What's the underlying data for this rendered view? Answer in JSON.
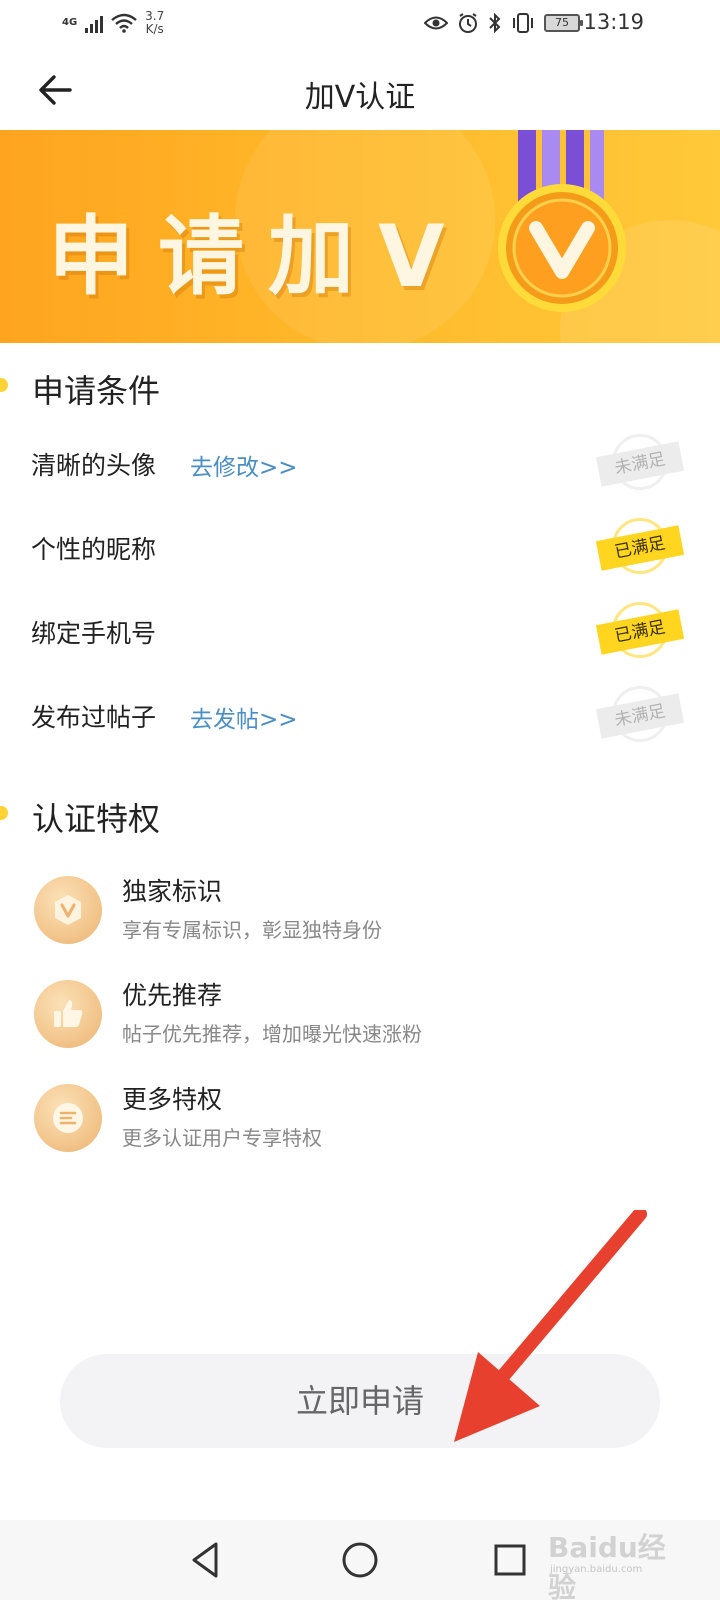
{
  "status_bar": {
    "network": "4G",
    "speed_value": "3.7",
    "speed_unit": "K/s",
    "battery": "75",
    "time": "13:19"
  },
  "header": {
    "title": "加V认证"
  },
  "banner": {
    "title": "申请加V"
  },
  "conditions": {
    "title": "申请条件",
    "items": [
      {
        "label": "清晰的头像",
        "link": "去修改>>",
        "status": "未满足"
      },
      {
        "label": "个性的昵称",
        "link": "",
        "status": "已满足"
      },
      {
        "label": "绑定手机号",
        "link": "",
        "status": "已满足"
      },
      {
        "label": "发布过帖子",
        "link": "去发帖>>",
        "status": "未满足"
      }
    ]
  },
  "privileges": {
    "title": "认证特权",
    "items": [
      {
        "name": "独家标识",
        "desc": "享有专属标识，彰显独特身份",
        "icon": "v-badge-icon"
      },
      {
        "name": "优先推荐",
        "desc": "帖子优先推荐，增加曝光快速涨粉",
        "icon": "thumbs-up-icon"
      },
      {
        "name": "更多特权",
        "desc": "更多认证用户专享特权",
        "icon": "more-lines-icon"
      }
    ]
  },
  "apply_button": {
    "label": "立即申请"
  },
  "watermark": {
    "text": "Baidu经验",
    "sub": "jingyan.baidu.com"
  },
  "colors": {
    "accent_yellow": "#ffd51f",
    "banner_orange": "#ffa41f",
    "link_blue": "#4a8ec8",
    "annotation_red": "#e8402e"
  }
}
